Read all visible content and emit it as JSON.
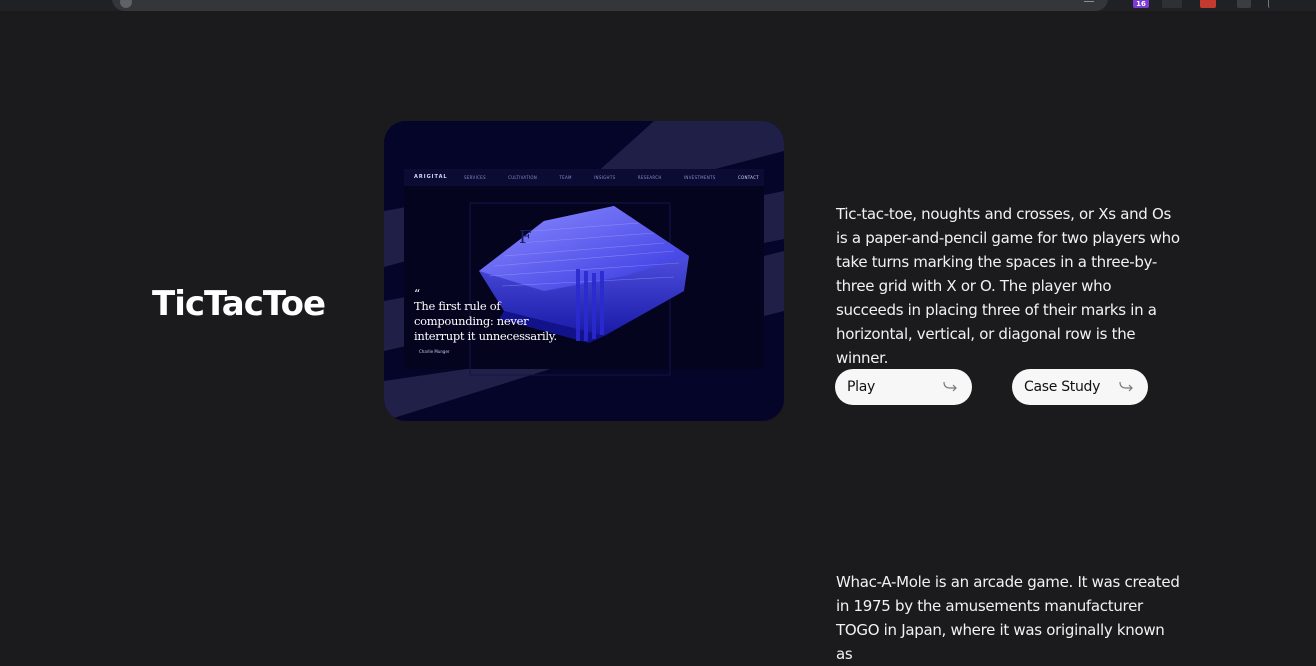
{
  "browser": {
    "extension_badge": "16"
  },
  "project1": {
    "title": "TicTacToe",
    "description": "Tic-tac-toe, noughts and crosses, or Xs and Os is a paper-and-pencil game for two players who take turns marking the spaces in a three-by-three grid with X or O. The player who succeeds in placing three of their marks in a horizontal, vertical, or diagonal row is the winner.",
    "preview": {
      "nav_logo": "ARIGITAL",
      "nav_items": [
        "SERVICES",
        "CULTIVATION",
        "TEAM",
        "INSIGHTS",
        "RESEARCH",
        "INVESTMENTS",
        "CONTACT"
      ],
      "quote_mark": "“",
      "quote_lines": [
        "The first rule of",
        "compounding: never",
        "interrupt it unnecessarily."
      ],
      "quote_author": "Charlie Munger"
    },
    "buttons": {
      "play": "Play",
      "case_study": "Case Study"
    }
  },
  "project2": {
    "description": "Whac-A-Mole is an arcade game. It was created in 1975 by the amusements manufacturer TOGO in Japan, where it was originally known as"
  },
  "colors": {
    "background": "#1b1b1d",
    "preview_bg": "#050529",
    "accent_blue": "#4a4aff",
    "button_bg": "#f7f7f7"
  },
  "icons": {
    "button_arrow": "return-arrow-icon"
  }
}
